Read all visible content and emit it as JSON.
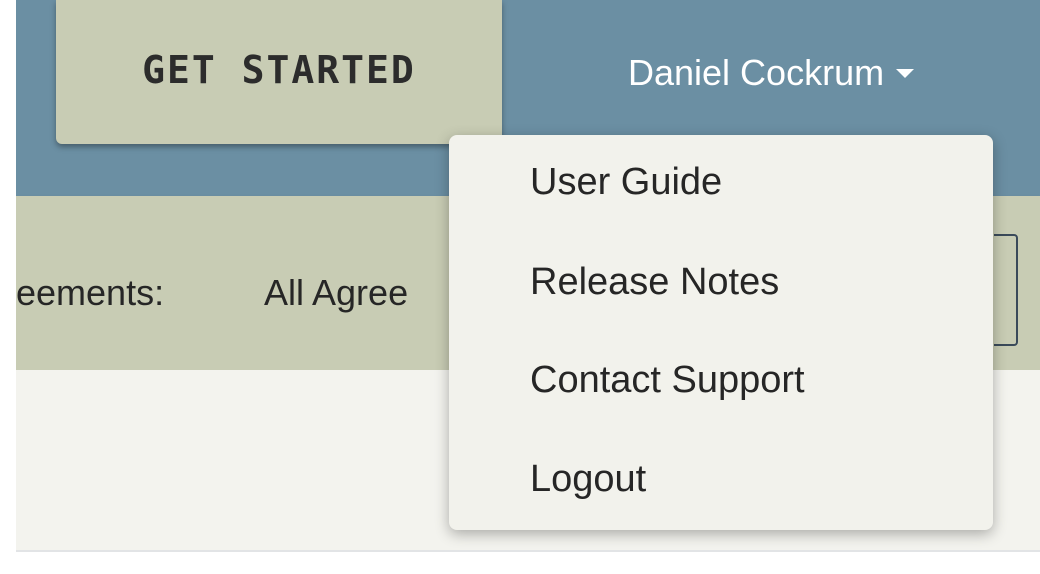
{
  "header": {
    "get_started_label": "GET STARTED",
    "user_name": "Daniel Cockrum"
  },
  "filter": {
    "label": "eements:",
    "value": "All Agree"
  },
  "user_menu": {
    "items": [
      {
        "label": "User Guide"
      },
      {
        "label": "Release Notes"
      },
      {
        "label": "Contact Support"
      },
      {
        "label": "Logout"
      }
    ]
  },
  "colors": {
    "topbar": "#6b8fa3",
    "button_and_filterbar": "#c8ccb4",
    "dropdown_bg": "#f2f2ec",
    "content_bg": "#f3f3ee"
  },
  "icons": {
    "user_menu_caret": "caret-down-icon"
  }
}
